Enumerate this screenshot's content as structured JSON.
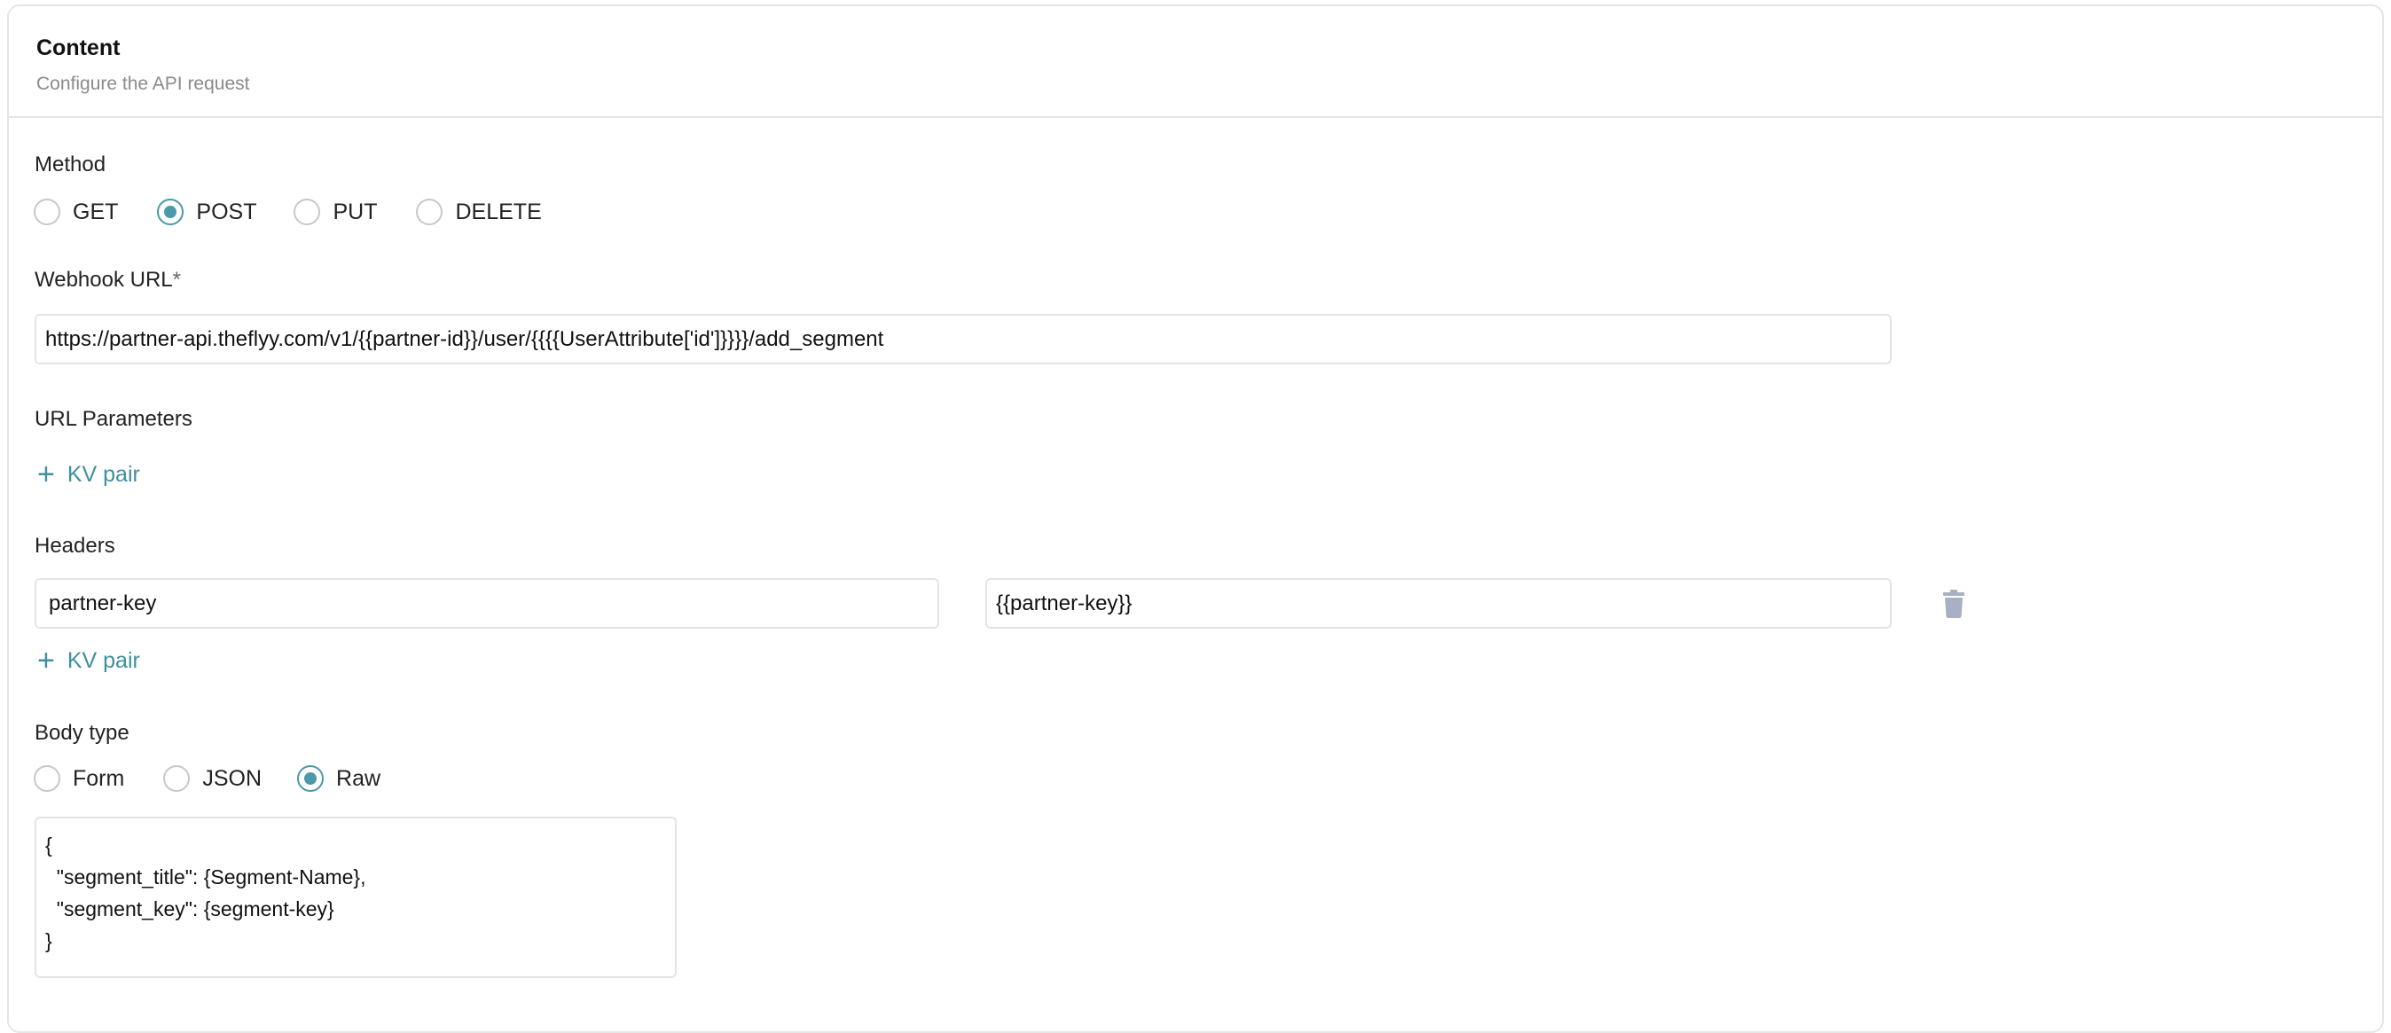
{
  "header": {
    "title": "Content",
    "subtitle": "Configure the API request"
  },
  "method": {
    "label": "Method",
    "options": [
      "GET",
      "POST",
      "PUT",
      "DELETE"
    ],
    "selected": "POST"
  },
  "webhook": {
    "label": "Webhook URL",
    "required_marker": "*",
    "value": "https://partner-api.theflyy.com/v1/{{partner-id}}/user/{{{{UserAttribute['id']}}}}/add_segment"
  },
  "url_params": {
    "label": "URL Parameters",
    "add_label": "KV pair"
  },
  "headers": {
    "label": "Headers",
    "rows": [
      {
        "key": "partner-key",
        "value": "{{partner-key}}"
      }
    ],
    "add_label": "KV pair"
  },
  "body_type": {
    "label": "Body type",
    "options": [
      "Form",
      "JSON",
      "Raw"
    ],
    "selected": "Raw",
    "raw_value": "{\n  \"segment_title\": {Segment-Name},\n  \"segment_key\": {segment-key}\n}"
  },
  "colors": {
    "accent": "#4a9aa8",
    "link": "#3f8f9f",
    "trash": "#a9b0c4"
  },
  "icons": {
    "add": "plus-icon",
    "delete": "trash-icon"
  }
}
